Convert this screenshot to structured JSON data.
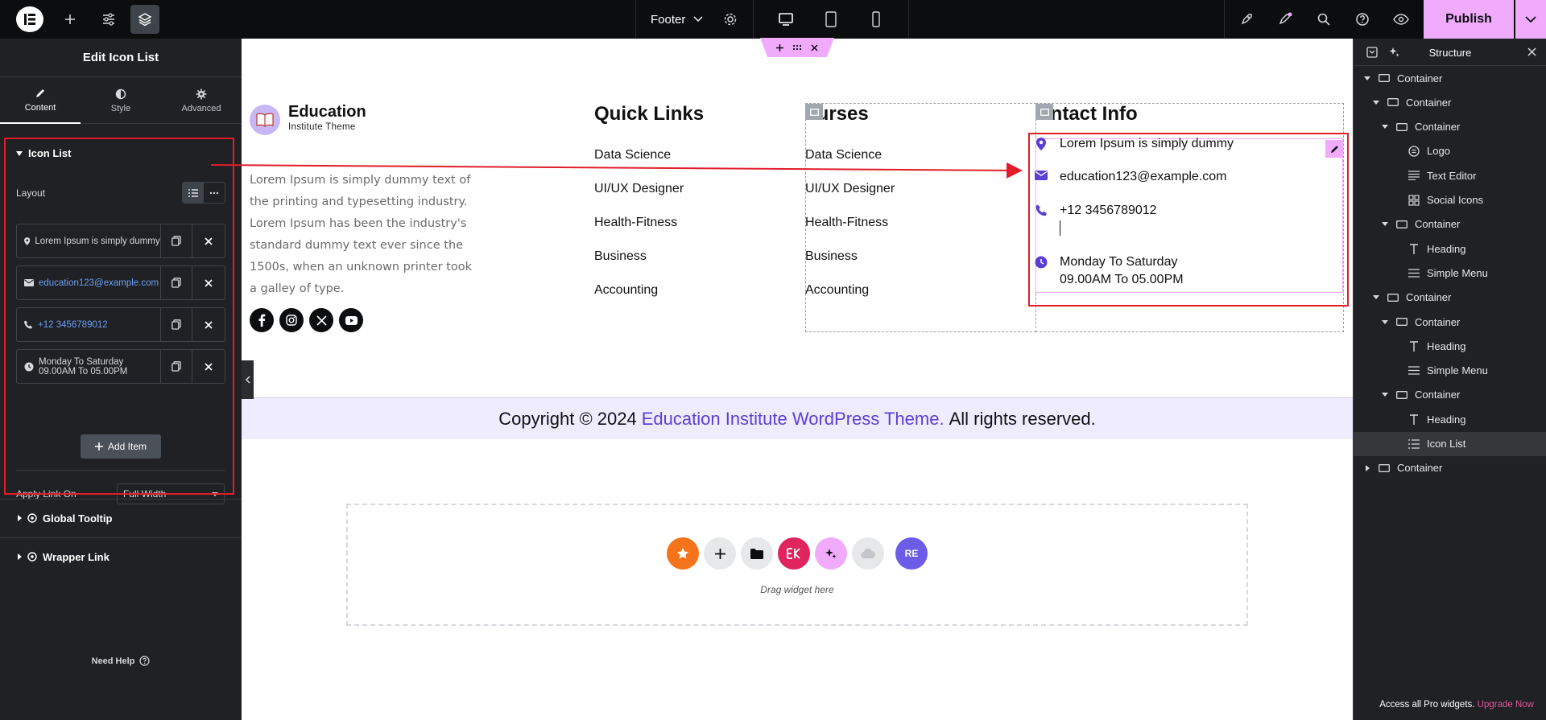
{
  "topbar": {
    "document_name": "Footer",
    "publish_label": "Publish",
    "colors": {
      "accent": "#f0abfc",
      "bg": "#0c0d0e"
    }
  },
  "left_panel": {
    "title": "Edit Icon List",
    "tabs": [
      {
        "label": "Content",
        "icon": "pencil-icon",
        "active": true
      },
      {
        "label": "Style",
        "icon": "half-circle-icon"
      },
      {
        "label": "Advanced",
        "icon": "gear-icon"
      }
    ],
    "section_title": "Icon List",
    "layout_label": "Layout",
    "items": [
      {
        "icon": "map-pin-icon",
        "text": "Lorem Ipsum is simply dummy"
      },
      {
        "icon": "envelope-icon",
        "text": "education123@example.com"
      },
      {
        "icon": "phone-icon",
        "text": "+12 3456789012"
      },
      {
        "icon": "clock-icon",
        "text_line1": "Monday To Saturday",
        "text_line2": "09.00AM To 05.00PM"
      }
    ],
    "add_item_label": "Add Item",
    "apply_link_label": "Apply Link On",
    "apply_link_value": "Full Width",
    "collapsed_sections": [
      "Global Tooltip",
      "Wrapper Link"
    ],
    "need_help": "Need Help"
  },
  "canvas": {
    "brand": {
      "title": "Education",
      "subtitle": "Institute Theme"
    },
    "about_text": "Lorem Ipsum is simply dummy text of the printing and typesetting industry. Lorem Ipsum has been the industry's standard dummy text ever since the 1500s, when an unknown printer took a galley of type.",
    "social_icons": [
      "facebook-icon",
      "instagram-icon",
      "x-icon",
      "youtube-icon"
    ],
    "quick_links": {
      "heading": "Quick Links",
      "items": [
        "Data Science",
        "UI/UX Designer",
        "Health-Fitness",
        "Business",
        "Accounting"
      ]
    },
    "courses": {
      "heading": "ourses",
      "items": [
        "Data Science",
        "UI/UX Designer",
        "Health-Fitness",
        "Business",
        "Accounting"
      ]
    },
    "contact": {
      "heading": "ontact Info",
      "items": [
        {
          "icon": "map-pin-icon",
          "text": "Lorem Ipsum is simply dummy"
        },
        {
          "icon": "envelope-icon",
          "text": "education123@example.com"
        },
        {
          "icon": "phone-icon",
          "text": "+12 3456789012"
        },
        {
          "icon": "clock-icon",
          "text_line1": "Monday To Saturday",
          "text_line2": "09.00AM To 05.00PM"
        }
      ]
    },
    "copyright": {
      "prefix": "Copyright © 2024",
      "link": "Education Institute WordPress Theme.",
      "suffix": "All rights reserved."
    },
    "drop_zone_text": "Drag widget here"
  },
  "structure_panel": {
    "title": "Structure",
    "tree": [
      {
        "label": "Container",
        "icon": "container-icon",
        "expanded": true
      },
      {
        "label": "Container",
        "icon": "container-icon",
        "expanded": true
      },
      {
        "label": "Container",
        "icon": "container-icon",
        "expanded": true
      },
      {
        "label": "Logo",
        "icon": "logo-icon"
      },
      {
        "label": "Text Editor",
        "icon": "text-editor-icon"
      },
      {
        "label": "Social Icons",
        "icon": "social-icons-icon"
      },
      {
        "label": "Container",
        "icon": "container-icon",
        "expanded": true
      },
      {
        "label": "Heading",
        "icon": "heading-icon"
      },
      {
        "label": "Simple Menu",
        "icon": "menu-icon"
      },
      {
        "label": "Container",
        "icon": "container-icon",
        "expanded": true
      },
      {
        "label": "Container",
        "icon": "container-icon",
        "expanded": true
      },
      {
        "label": "Heading",
        "icon": "heading-icon"
      },
      {
        "label": "Simple Menu",
        "icon": "menu-icon"
      },
      {
        "label": "Container",
        "icon": "container-icon",
        "expanded": true
      },
      {
        "label": "Heading",
        "icon": "heading-icon"
      },
      {
        "label": "Icon List",
        "icon": "icon-list-icon",
        "selected": true
      },
      {
        "label": "Container",
        "icon": "container-icon",
        "expanded": false
      }
    ],
    "footer_text": "Access all Pro widgets.",
    "footer_link": "Upgrade Now"
  }
}
